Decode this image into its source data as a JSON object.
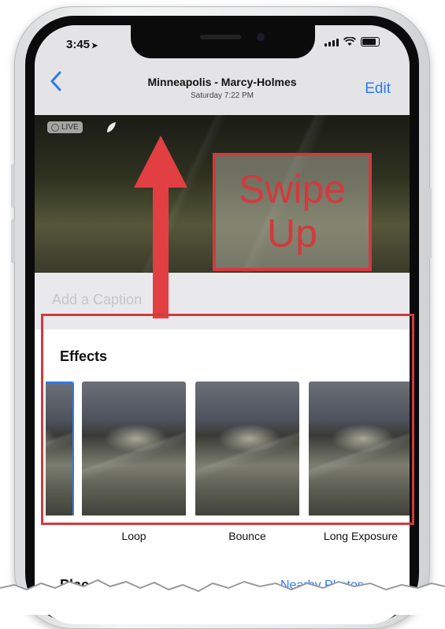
{
  "status": {
    "time": "3:45"
  },
  "nav": {
    "title": "Minneapolis - Marcy-Holmes",
    "subtitle": "Saturday  7:22 PM",
    "edit_label": "Edit"
  },
  "photo": {
    "live_label": "LIVE"
  },
  "annotation": {
    "line1": "Swipe",
    "line2": "Up"
  },
  "caption": {
    "placeholder": "Add a Caption"
  },
  "effects": {
    "title": "Effects",
    "items": [
      {
        "label": "Loop"
      },
      {
        "label": "Bounce"
      },
      {
        "label": "Long Exposure"
      }
    ]
  },
  "places": {
    "title": "Places",
    "link": "Nearby Photos"
  },
  "colors": {
    "accent": "#2a7bf3",
    "highlight": "#d23a3d"
  }
}
